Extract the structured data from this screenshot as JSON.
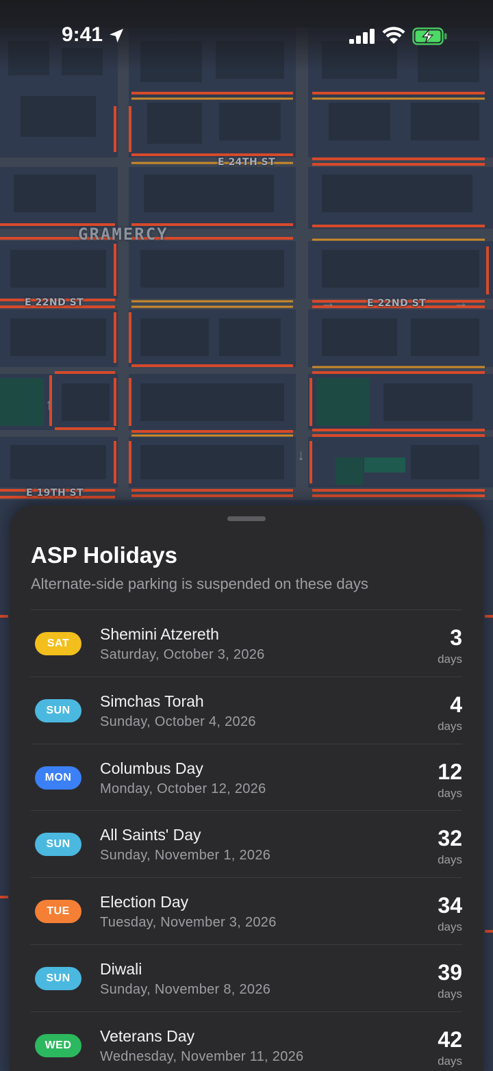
{
  "status_bar": {
    "time": "9:41"
  },
  "map": {
    "neighborhood": "GRAMERCY",
    "streets": {
      "e24": "E 24TH ST",
      "e22_left": "E 22ND ST",
      "e22_right": "E 22ND ST",
      "e19": "E 19TH ST"
    }
  },
  "sheet": {
    "title": "ASP Holidays",
    "subtitle": "Alternate-side parking is suspended on these days",
    "holidays": [
      {
        "day": "SAT",
        "badge_color": "#f3bf1d",
        "name": "Shemini Atzereth",
        "date": "Saturday, October 3, 2026",
        "days": "3",
        "unit": "days"
      },
      {
        "day": "SUN",
        "badge_color": "#4bb8df",
        "name": "Simchas Torah",
        "date": "Sunday, October 4, 2026",
        "days": "4",
        "unit": "days"
      },
      {
        "day": "MON",
        "badge_color": "#3b80f6",
        "name": "Columbus Day",
        "date": "Monday, October 12, 2026",
        "days": "12",
        "unit": "days"
      },
      {
        "day": "SUN",
        "badge_color": "#4bb8df",
        "name": "All Saints' Day",
        "date": "Sunday, November 1, 2026",
        "days": "32",
        "unit": "days"
      },
      {
        "day": "TUE",
        "badge_color": "#f57f35",
        "name": "Election Day",
        "date": "Tuesday, November 3, 2026",
        "days": "34",
        "unit": "days"
      },
      {
        "day": "SUN",
        "badge_color": "#4bb8df",
        "name": "Diwali",
        "date": "Sunday, November 8, 2026",
        "days": "39",
        "unit": "days"
      },
      {
        "day": "WED",
        "badge_color": "#2cb85e",
        "name": "Veterans Day",
        "date": "Wednesday, November 11, 2026",
        "days": "42",
        "unit": "days"
      }
    ]
  }
}
